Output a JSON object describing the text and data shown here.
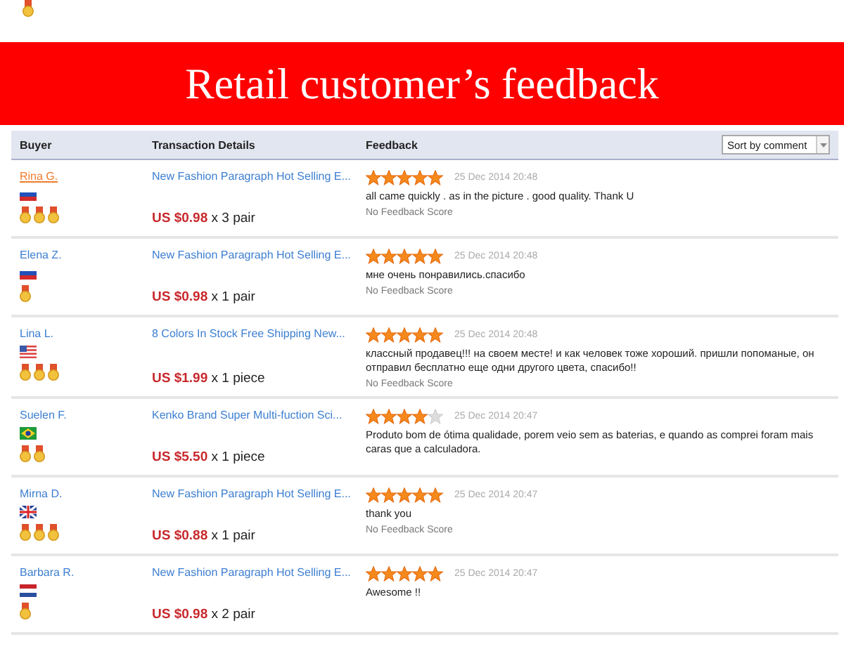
{
  "top_item": {
    "badges": [
      {
        "kind": "medal"
      }
    ]
  },
  "banner": {
    "title": "Retail customer’s feedback"
  },
  "table": {
    "columns": [
      "Buyer",
      "Transaction Details",
      "Feedback"
    ],
    "sort": {
      "value": "Sort by comment"
    },
    "rows": [
      {
        "buyer": "Rina G.",
        "hovered": true,
        "flag": {
          "kind": "russia"
        },
        "badges": [
          {
            "kind": "medal"
          },
          {
            "kind": "medal"
          },
          {
            "kind": "medal"
          }
        ],
        "product": "New Fashion Paragraph Hot Selling E...",
        "price": "US $0.98",
        "quantity": "x 3 pair",
        "stars": 5,
        "date": "25 Dec 2014 20:48",
        "comment": "all came quickly . as in the picture . good quality. Thank U",
        "score": "No Feedback Score"
      },
      {
        "buyer": "Elena Z.",
        "hovered": false,
        "flag": {
          "kind": "russia"
        },
        "badges": [
          {
            "kind": "medal"
          }
        ],
        "product": "New Fashion Paragraph Hot Selling E...",
        "price": "US $0.98",
        "quantity": "x 1 pair",
        "stars": 5,
        "date": "25 Dec 2014 20:48",
        "comment": "мне очень понравились.спасибо",
        "score": "No Feedback Score"
      },
      {
        "buyer": "Lina L.",
        "hovered": false,
        "flag": {
          "kind": "usa"
        },
        "badges": [
          {
            "kind": "medal"
          },
          {
            "kind": "medal"
          },
          {
            "kind": "medal"
          }
        ],
        "product": "8 Colors In Stock Free Shipping New...",
        "price": "US $1.99",
        "quantity": "x 1 piece",
        "stars": 5,
        "date": "25 Dec 2014 20:48",
        "comment": "классный продавец!!! на своем месте! и как человек тоже хороший. пришли попоманые, он отправил бесплатно еще одни другого цвета, спасибо!!",
        "score": "No Feedback Score"
      },
      {
        "buyer": "Suelen F.",
        "hovered": false,
        "flag": {
          "kind": "brazil"
        },
        "badges": [
          {
            "kind": "medal"
          },
          {
            "kind": "medal"
          }
        ],
        "product": "Kenko Brand Super Multi-fuction Sci...",
        "price": "US $5.50",
        "quantity": "x 1 piece",
        "stars": 4,
        "date": "25 Dec 2014 20:47",
        "comment": "Produto bom de ótima qualidade, porem veio sem as baterias, e quando as comprei foram mais caras que a calculadora."
      },
      {
        "buyer": "Mirna D.",
        "hovered": false,
        "flag": {
          "kind": "uk"
        },
        "badges": [
          {
            "kind": "medal"
          },
          {
            "kind": "medal"
          },
          {
            "kind": "medal"
          }
        ],
        "product": "New Fashion Paragraph Hot Selling E...",
        "price": "US $0.88",
        "quantity": "x 1 pair",
        "stars": 5,
        "date": "25 Dec 2014 20:47",
        "comment": "thank you",
        "score": "No Feedback Score"
      },
      {
        "buyer": "Barbara R.",
        "hovered": false,
        "flag": {
          "kind": "netherlands"
        },
        "badges": [
          {
            "kind": "medal"
          }
        ],
        "product": "New Fashion Paragraph Hot Selling E...",
        "price": "US $0.98",
        "quantity": "x 2 pair",
        "stars": 5,
        "date": "25 Dec 2014 20:47",
        "comment": "Awesome !!"
      }
    ]
  }
}
